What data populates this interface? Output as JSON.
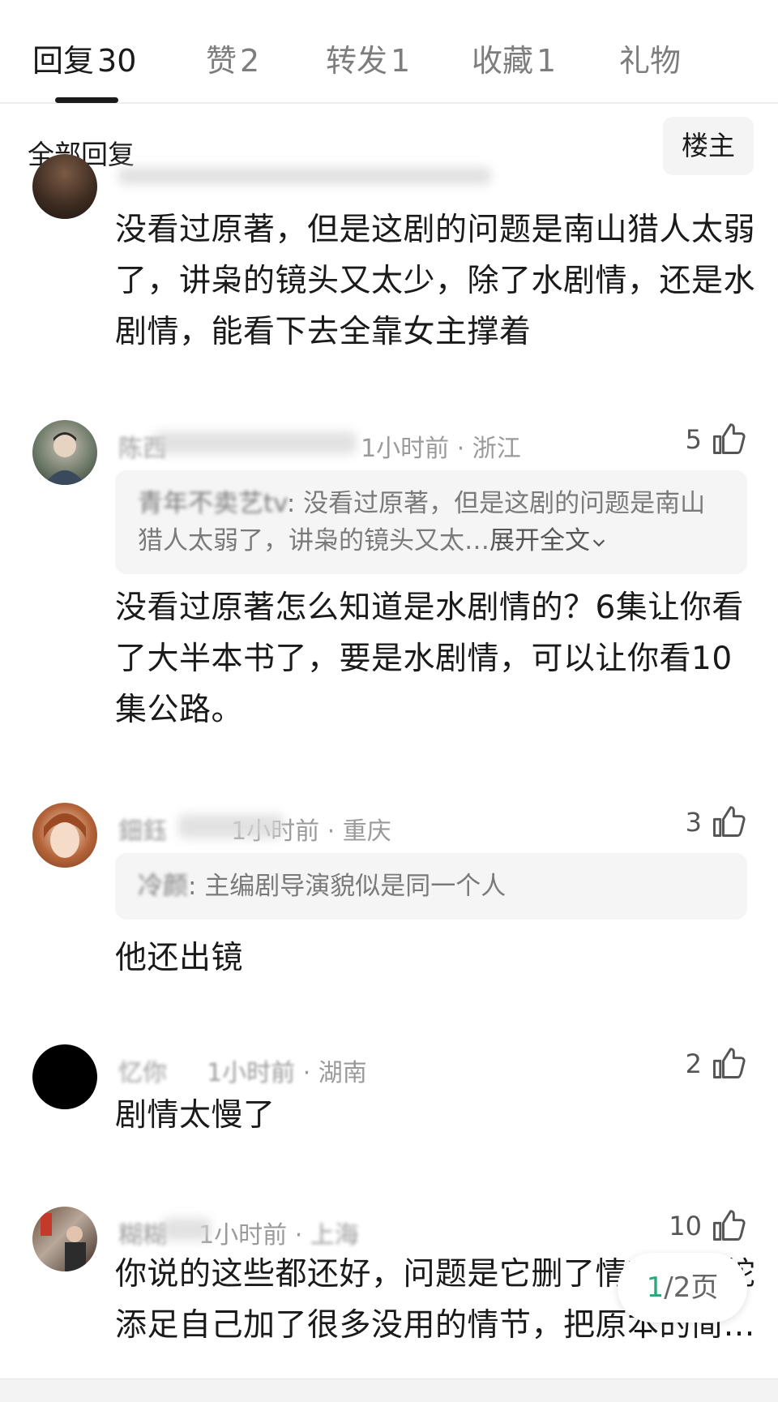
{
  "tabs": [
    {
      "label": "回复",
      "count": "30"
    },
    {
      "label": "赞",
      "count": "2"
    },
    {
      "label": "转发",
      "count": "1"
    },
    {
      "label": "收藏",
      "count": "1"
    },
    {
      "label": "礼物",
      "count": ""
    }
  ],
  "filter": {
    "label": "全部回复",
    "op_button": "楼主"
  },
  "comments": [
    {
      "body": "没看过原著，但是这剧的问题是南山猎人太弱了，讲枭的镜头又太少，除了水剧情，还是水剧情，能看下去全靠女主撑着"
    },
    {
      "name": "陈西",
      "time": "1小时前",
      "location": "浙江",
      "likes": "5",
      "quote_name": "青年不卖艺tv",
      "quote_text": "没看过原著，但是这剧的问题是南山猎人太弱了，讲枭的镜头又太…",
      "expand": "展开全文",
      "body": "没看过原著怎么知道是水剧情的？6集让你看了大半本书了，要是水剧情，可以让你看10集公路。"
    },
    {
      "name": "鈿鈺",
      "time": "1小时前",
      "location": "重庆",
      "likes": "3",
      "quote_name": "冷颜",
      "quote_text": "主编剧导演貌似是同一个人",
      "body": "他还出镜"
    },
    {
      "name": "忆你",
      "time": "1小时前",
      "location": "湖南",
      "likes": "2",
      "body": "剧情太慢了"
    },
    {
      "name": "糊糊",
      "time": "1小时前",
      "location": "上海",
      "likes": "10",
      "body": "你说的这些都还好，问题是它删了情节，画蛇添足自己加了很多没用的情节，把原本的简…"
    }
  ],
  "pager": {
    "current": "1",
    "total": "/2页"
  },
  "icons": {
    "like": "thumbs-up-icon"
  },
  "colors": {
    "accent": "#2ba677",
    "text": "#1a1a1a",
    "muted": "#9a9a9a",
    "quote_bg": "#f5f5f5"
  }
}
